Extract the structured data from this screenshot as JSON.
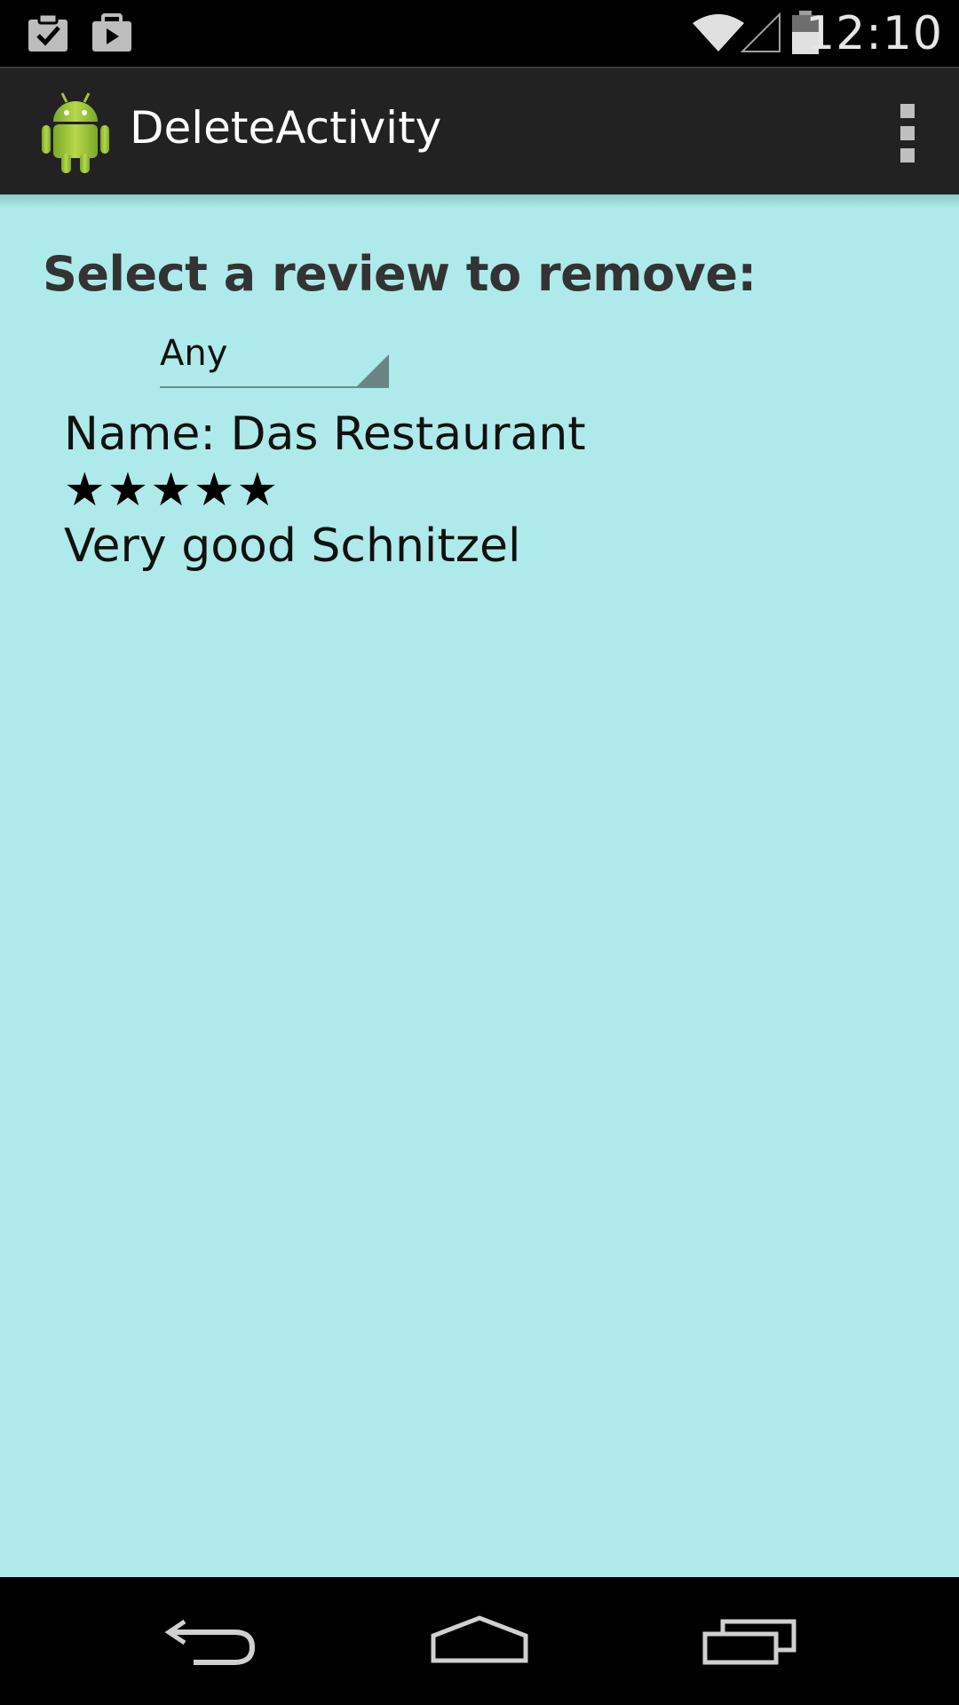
{
  "status_bar": {
    "time": "12:10",
    "icons": [
      "clipboard-check-icon",
      "briefcase-play-icon",
      "wifi-icon",
      "cellular-signal-icon",
      "battery-icon"
    ]
  },
  "action_bar": {
    "title": "DeleteActivity",
    "icons": [
      "android-app-icon",
      "overflow-menu-icon"
    ]
  },
  "content": {
    "heading": "Select a review to remove:",
    "spinner": {
      "selected": "Any"
    },
    "review": {
      "name": "Name: Das Restaurant",
      "stars_text": "★★★★★",
      "rating": 5,
      "rating_max": 5,
      "comment": "Very good Schnitzel"
    }
  },
  "nav_bar": {
    "icons": [
      "back-icon",
      "home-icon",
      "recent-apps-icon"
    ]
  },
  "colors": {
    "content_background": "#afeaea",
    "action_bar": "#222222",
    "android_green": "#a4c639"
  }
}
